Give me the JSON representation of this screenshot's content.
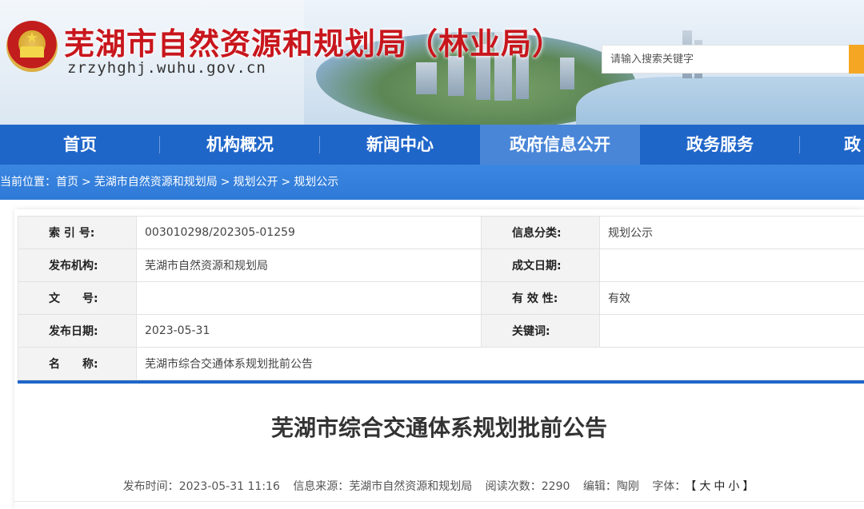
{
  "header": {
    "site_title": "芜湖市自然资源和规划局（林业局）",
    "domain": "zrzyhghj.wuhu.gov.cn",
    "emblem_icon": "national-emblem-icon",
    "search": {
      "placeholder": "请输入搜索关键字",
      "value": ""
    },
    "colors": {
      "title": "#c8161d",
      "search_button": "#f5a623"
    }
  },
  "nav": {
    "items": [
      {
        "label": "首页",
        "active": false
      },
      {
        "label": "机构概况",
        "active": false
      },
      {
        "label": "新闻中心",
        "active": false
      },
      {
        "label": "政府信息公开",
        "active": true
      },
      {
        "label": "政务服务",
        "active": false
      },
      {
        "label": "政",
        "active": false
      }
    ],
    "colors": {
      "bar": "#1f66c9",
      "active": "#4a86d8"
    }
  },
  "breadcrumb": {
    "prefix": "当前位置：",
    "items": [
      "首页",
      "芜湖市自然资源和规划局",
      "规划公开",
      "规划公示"
    ],
    "separator": ">"
  },
  "meta": {
    "rows": [
      {
        "label1": "索 引 号:",
        "value1": "003010298/202305-01259",
        "label2": "信息分类:",
        "value2": "规划公示"
      },
      {
        "label1": "发布机构:",
        "value1": "芜湖市自然资源和规划局",
        "label2": "成文日期:",
        "value2": ""
      },
      {
        "label1": "文　　号:",
        "value1": "",
        "label2": "有 效 性:",
        "value2": "有效"
      },
      {
        "label1": "发布日期:",
        "value1": "2023-05-31",
        "label2": "关键词:",
        "value2": ""
      },
      {
        "label1": "名　　称:",
        "value1": "芜湖市综合交通体系规划批前公告"
      }
    ]
  },
  "article": {
    "title": "芜湖市综合交通体系规划批前公告",
    "publish_time_label": "发布时间：",
    "publish_time": "2023-05-31 11:16",
    "source_label": "信息来源：",
    "source": "芜湖市自然资源和规划局",
    "views_label": "阅读次数：",
    "views": "2290",
    "editor_label": "编辑：",
    "editor": "陶刚",
    "font_label": "字体：",
    "font_open": "【",
    "font_large": "大",
    "font_medium": "中",
    "font_small": "小",
    "font_close": "】"
  }
}
